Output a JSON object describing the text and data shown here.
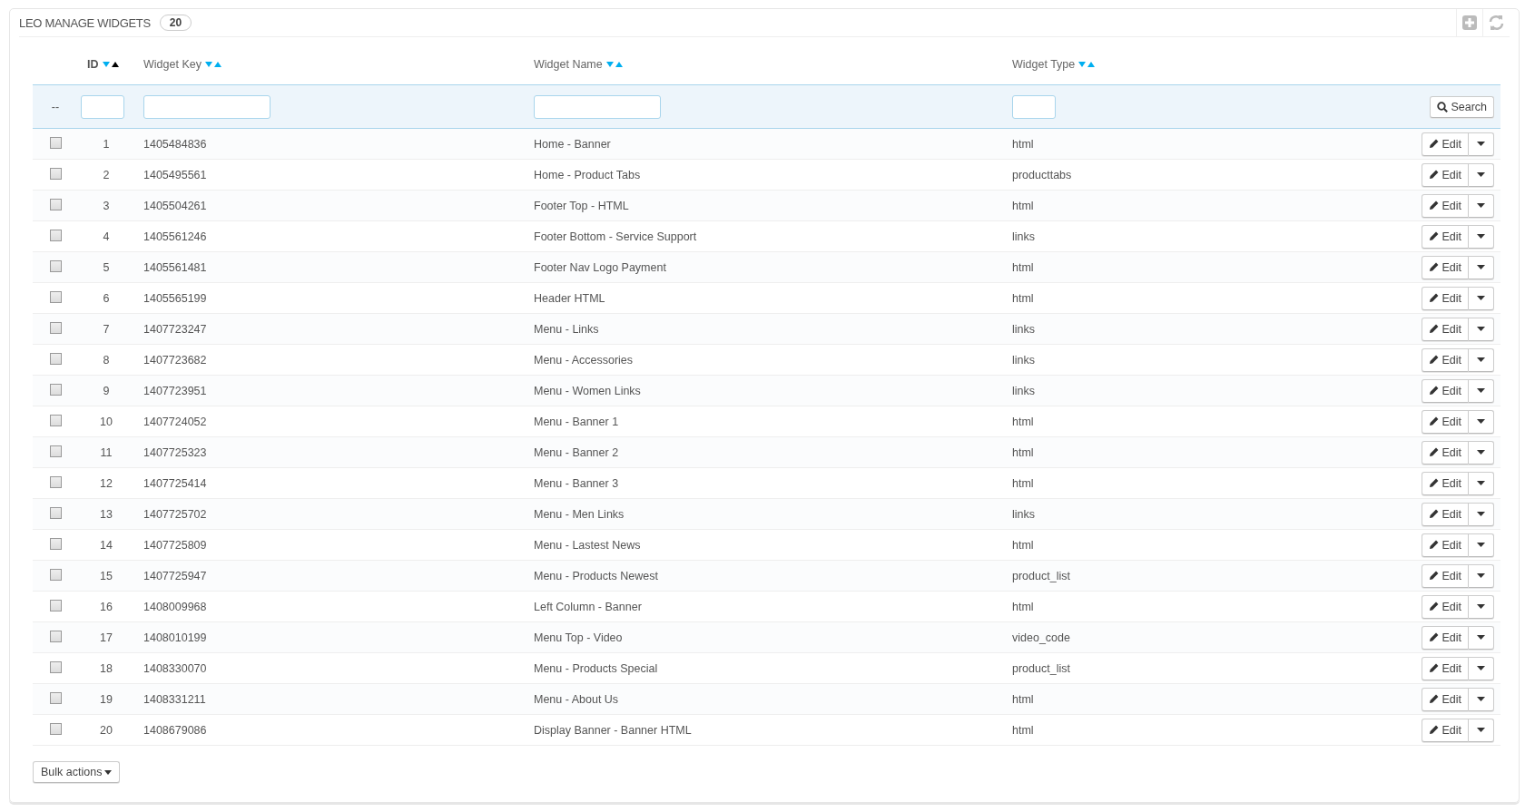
{
  "panel": {
    "title": "LEO MANAGE WIDGETS",
    "count": "20"
  },
  "columns": [
    {
      "label": "ID",
      "sorted_ascending": true
    },
    {
      "label": "Widget Key",
      "sorted_ascending": false
    },
    {
      "label": "Widget Name",
      "sorted_ascending": false
    },
    {
      "label": "Widget Type",
      "sorted_ascending": false
    }
  ],
  "filter": {
    "checkbox_placeholder": "--",
    "search_button": "Search"
  },
  "rows": [
    {
      "checked": false,
      "id": "1",
      "key": "1405484836",
      "name": "Home - Banner",
      "type": "html",
      "action": "Edit"
    },
    {
      "checked": false,
      "id": "2",
      "key": "1405495561",
      "name": "Home - Product Tabs",
      "type": "producttabs",
      "action": "Edit"
    },
    {
      "checked": false,
      "id": "3",
      "key": "1405504261",
      "name": "Footer Top - HTML",
      "type": "html",
      "action": "Edit"
    },
    {
      "checked": false,
      "id": "4",
      "key": "1405561246",
      "name": "Footer Bottom - Service Support",
      "type": "links",
      "action": "Edit"
    },
    {
      "checked": false,
      "id": "5",
      "key": "1405561481",
      "name": "Footer Nav Logo Payment",
      "type": "html",
      "action": "Edit"
    },
    {
      "checked": false,
      "id": "6",
      "key": "1405565199",
      "name": "Header HTML",
      "type": "html",
      "action": "Edit"
    },
    {
      "checked": false,
      "id": "7",
      "key": "1407723247",
      "name": "Menu - Links",
      "type": "links",
      "action": "Edit"
    },
    {
      "checked": false,
      "id": "8",
      "key": "1407723682",
      "name": "Menu - Accessories",
      "type": "links",
      "action": "Edit"
    },
    {
      "checked": false,
      "id": "9",
      "key": "1407723951",
      "name": "Menu - Women Links",
      "type": "links",
      "action": "Edit"
    },
    {
      "checked": false,
      "id": "10",
      "key": "1407724052",
      "name": "Menu - Banner 1",
      "type": "html",
      "action": "Edit"
    },
    {
      "checked": false,
      "id": "11",
      "key": "1407725323",
      "name": "Menu - Banner 2",
      "type": "html",
      "action": "Edit"
    },
    {
      "checked": false,
      "id": "12",
      "key": "1407725414",
      "name": "Menu - Banner 3",
      "type": "html",
      "action": "Edit"
    },
    {
      "checked": false,
      "id": "13",
      "key": "1407725702",
      "name": "Menu - Men Links",
      "type": "links",
      "action": "Edit"
    },
    {
      "checked": false,
      "id": "14",
      "key": "1407725809",
      "name": "Menu - Lastest News",
      "type": "html",
      "action": "Edit"
    },
    {
      "checked": false,
      "id": "15",
      "key": "1407725947",
      "name": "Menu - Products Newest",
      "type": "product_list",
      "action": "Edit"
    },
    {
      "checked": false,
      "id": "16",
      "key": "1408009968",
      "name": "Left Column - Banner",
      "type": "html",
      "action": "Edit"
    },
    {
      "checked": false,
      "id": "17",
      "key": "1408010199",
      "name": "Menu Top - Video",
      "type": "video_code",
      "action": "Edit"
    },
    {
      "checked": false,
      "id": "18",
      "key": "1408330070",
      "name": "Menu - Products Special",
      "type": "product_list",
      "action": "Edit"
    },
    {
      "checked": false,
      "id": "19",
      "key": "1408331211",
      "name": "Menu - About Us",
      "type": "html",
      "action": "Edit"
    },
    {
      "checked": false,
      "id": "20",
      "key": "1408679086",
      "name": "Display Banner - Banner HTML",
      "type": "html",
      "action": "Edit"
    }
  ],
  "bulk_button": "Bulk actions"
}
